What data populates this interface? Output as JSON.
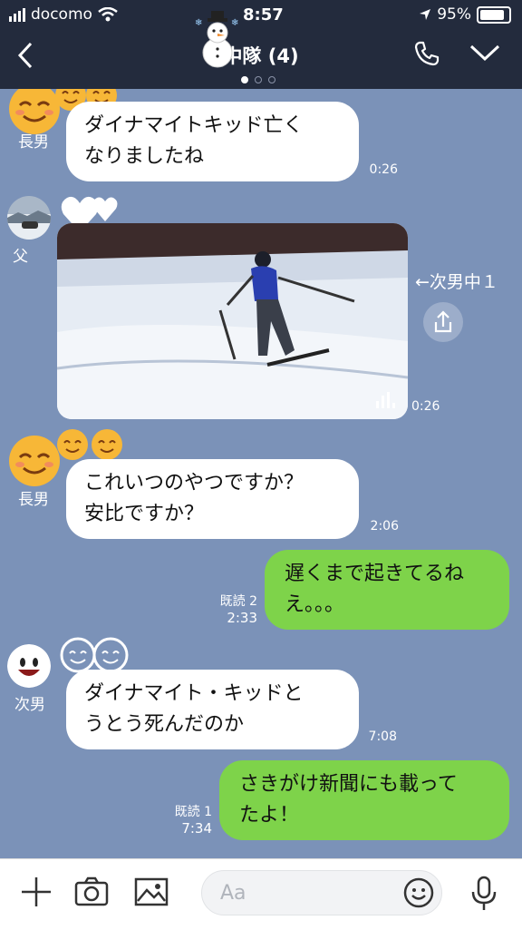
{
  "status_bar": {
    "carrier": "docomo",
    "time": "8:57",
    "battery": "95%"
  },
  "header": {
    "title": "中隊 (4)",
    "back_icon": "chevron-left-icon",
    "call_icon": "phone-icon",
    "menu_icon": "chevron-down-icon",
    "page_count": 3,
    "active_page": 1
  },
  "messages": [
    {
      "sender": "長男",
      "text_lines": [
        "ダイナマイトキッド亡く",
        "なりましたね"
      ],
      "time": "0:26"
    },
    {
      "sender": "父",
      "type": "video",
      "forward_label": "←次男中１",
      "time": "0:26"
    },
    {
      "sender": "長男",
      "text_lines": [
        "これいつのやつですか？",
        "安比ですか？"
      ],
      "time": "2:06"
    },
    {
      "direction": "out",
      "text_lines": [
        "遅くまで起きてるね",
        "え。。。"
      ],
      "read": "既読 2",
      "time": "2:33"
    },
    {
      "sender": "次男",
      "text_lines": [
        "ダイナマイト・キッドと",
        "うとう死んだのか"
      ],
      "time": "7:08"
    },
    {
      "direction": "out",
      "text_lines": [
        "さきがけ新聞にも載って",
        "たよ！"
      ],
      "read": "既読 1",
      "time": "7:34"
    }
  ],
  "input_bar": {
    "placeholder": "Aa",
    "icons": [
      "plus-icon",
      "camera-icon",
      "image-icon",
      "emoji-icon",
      "microphone-icon"
    ]
  },
  "colors": {
    "header_bg": "#232b3d",
    "chat_bg": "#7b92b8",
    "outgoing_bubble": "#7ed34a",
    "incoming_bubble": "#ffffff"
  }
}
